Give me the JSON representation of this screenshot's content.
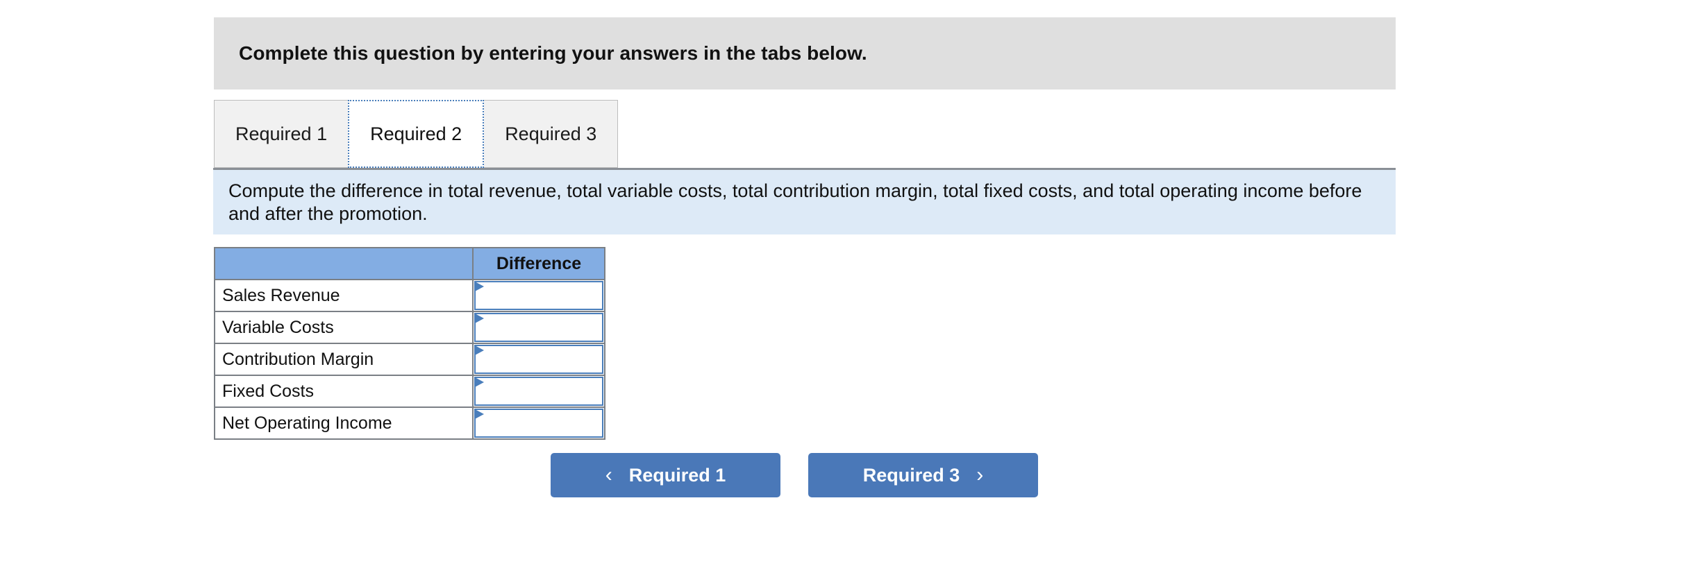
{
  "header": {
    "banner_text": "Complete this question by entering your answers in the tabs below."
  },
  "tabs": [
    {
      "label": "Required 1",
      "active": false
    },
    {
      "label": "Required 2",
      "active": true
    },
    {
      "label": "Required 3",
      "active": false
    }
  ],
  "instruction": {
    "text": "Compute the difference in total revenue, total variable costs, total contribution margin, total fixed costs, and total operating income before and after the promotion."
  },
  "table": {
    "headers": [
      "",
      "Difference"
    ],
    "rows": [
      {
        "label": "Sales Revenue",
        "difference": ""
      },
      {
        "label": "Variable Costs",
        "difference": ""
      },
      {
        "label": "Contribution Margin",
        "difference": ""
      },
      {
        "label": "Fixed Costs",
        "difference": ""
      },
      {
        "label": "Net Operating Income",
        "difference": ""
      }
    ]
  },
  "nav": {
    "prev_label": "Required 1",
    "next_label": "Required 3",
    "prev_icon": "chevron-left-icon",
    "next_icon": "chevron-right-icon",
    "chevron_left_glyph": "‹",
    "chevron_right_glyph": "›"
  },
  "colors": {
    "banner_bg": "#dfdfdf",
    "instruction_bg": "#ddeaf7",
    "table_header_bg": "#83ade3",
    "button_bg": "#4a78b8",
    "input_border": "#4a7ebb",
    "tab_inactive_bg": "#f1f1f1",
    "table_border": "#7a7f85"
  }
}
